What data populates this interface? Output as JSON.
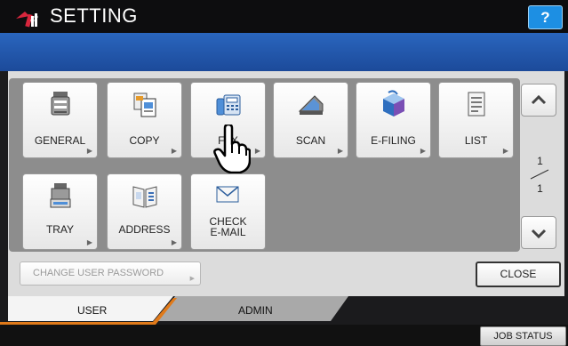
{
  "header": {
    "title": "SETTING",
    "help_label": "?"
  },
  "functions": [
    {
      "label": "GENERAL",
      "icon": "general-icon",
      "has_arrow": true
    },
    {
      "label": "COPY",
      "icon": "copy-icon",
      "has_arrow": true
    },
    {
      "label": "FAX",
      "icon": "fax-icon",
      "has_arrow": true
    },
    {
      "label": "SCAN",
      "icon": "scan-icon",
      "has_arrow": true
    },
    {
      "label": "E-FILING",
      "icon": "efiling-icon",
      "has_arrow": true
    },
    {
      "label": "LIST",
      "icon": "list-icon",
      "has_arrow": true
    },
    {
      "label": "TRAY",
      "icon": "tray-icon",
      "has_arrow": true
    },
    {
      "label": "ADDRESS",
      "icon": "address-icon",
      "has_arrow": true
    },
    {
      "label_line1": "CHECK",
      "label_line2": "E-MAIL",
      "icon": "check-email-icon",
      "has_arrow": false
    }
  ],
  "pagination": {
    "current": "1",
    "total": "1"
  },
  "buttons": {
    "change_password": "CHANGE USER PASSWORD",
    "close": "CLOSE",
    "job_status": "JOB STATUS"
  },
  "tabs": [
    {
      "label": "USER",
      "active": true
    },
    {
      "label": "ADMIN",
      "active": false
    }
  ],
  "colors": {
    "accent_blue": "#1d8fe3",
    "header_bar": "#1c4a9a",
    "tab_accent": "#e07a1a"
  }
}
